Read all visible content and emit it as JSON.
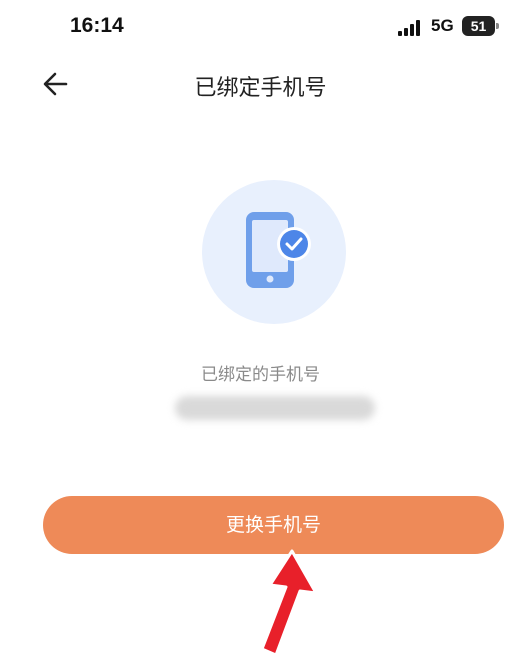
{
  "status_bar": {
    "time": "16:14",
    "network": "5G",
    "battery": "51"
  },
  "header": {
    "title": "已绑定手机号"
  },
  "main": {
    "label": "已绑定的手机号",
    "phone_number_redacted": "",
    "change_button": "更换手机号"
  },
  "colors": {
    "accent": "#ee8a58",
    "icon_blue": "#6f9fea",
    "hero_bg": "#e8f0fd",
    "annotation_arrow": "#e8202a"
  }
}
